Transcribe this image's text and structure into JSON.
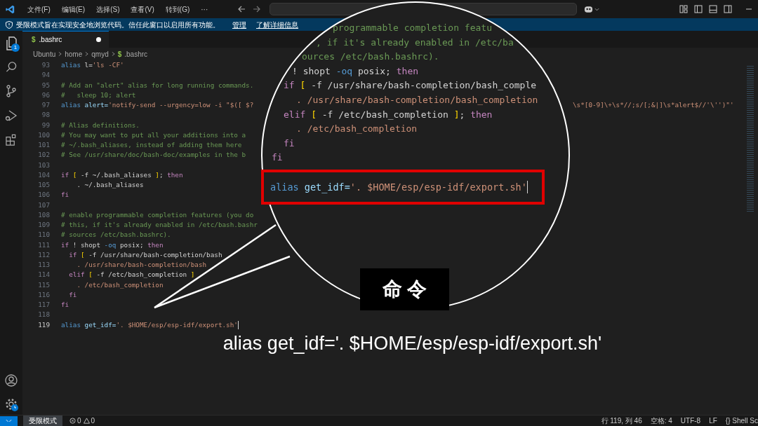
{
  "title_bar": {
    "menus": [
      "文件(F)",
      "编辑(E)",
      "选择(S)",
      "查看(V)",
      "转到(G)",
      "···"
    ]
  },
  "banner": {
    "message": "受限模式旨在实现安全地浏览代码。信任此窗口以启用所有功能。",
    "links": [
      "管理",
      "了解详细信息"
    ]
  },
  "activity_bar": {
    "explorer_badge": "1"
  },
  "tabs": [
    {
      "icon": "$",
      "label": ".bashrc",
      "modified": true,
      "selected": true
    }
  ],
  "breadcrumbs": [
    {
      "text": "Ubuntu"
    },
    {
      "text": "home"
    },
    {
      "text": "qmyd"
    },
    {
      "icon": "$",
      "text": ".bashrc"
    }
  ],
  "editor": {
    "lines": [
      {
        "number": "93",
        "segments": [
          {
            "text": "alias ",
            "kind": "keyword"
          },
          {
            "text": "l=",
            "kind": "plain"
          },
          {
            "text": "'ls -CF'",
            "kind": "string"
          }
        ]
      },
      {
        "number": "94"
      },
      {
        "number": "95",
        "segments": [
          {
            "text": "# Add an \"alert\" alias for long running commands.",
            "kind": "comment"
          }
        ]
      },
      {
        "number": "96",
        "segments": [
          {
            "text": "#   sleep 10; alert",
            "kind": "comment"
          }
        ]
      },
      {
        "number": "97",
        "segments": [
          {
            "text": "alias ",
            "kind": "keyword"
          },
          {
            "text": "alert=",
            "kind": "name"
          },
          {
            "text": "'notify-send --urgency=low -i \"$([ $?",
            "kind": "string"
          }
        ],
        "tail": "\\s*[0-9]\\+\\s*//;s/[;&|]\\s*alert$//'\\'')\"'"
      },
      {
        "number": "98"
      },
      {
        "number": "99",
        "segments": [
          {
            "text": "# Alias definitions.",
            "kind": "comment"
          }
        ]
      },
      {
        "number": "100",
        "segments": [
          {
            "text": "# You may want to put all your additions into a",
            "kind": "comment"
          }
        ]
      },
      {
        "number": "101",
        "segments": [
          {
            "text": "# ~/.bash_aliases, instead of adding them here",
            "kind": "comment"
          }
        ]
      },
      {
        "number": "102",
        "segments": [
          {
            "text": "# See /usr/share/doc/bash-doc/examples in the b",
            "kind": "comment"
          }
        ]
      },
      {
        "number": "103"
      },
      {
        "number": "104",
        "segments": [
          {
            "text": "if ",
            "kind": "control"
          },
          {
            "text": "[ ",
            "kind": "bracket"
          },
          {
            "text": "-f ~/.bash_aliases ",
            "kind": "plain"
          },
          {
            "text": "]",
            "kind": "bracket"
          },
          {
            "text": "; ",
            "kind": "plain"
          },
          {
            "text": "then",
            "kind": "control"
          }
        ]
      },
      {
        "number": "105",
        "segments": [
          {
            "text": "    . ~/.bash_aliases",
            "kind": "plain"
          }
        ]
      },
      {
        "number": "106",
        "segments": [
          {
            "text": "fi",
            "kind": "control"
          }
        ]
      },
      {
        "number": "107"
      },
      {
        "number": "108",
        "segments": [
          {
            "text": "# enable programmable completion features (you do",
            "kind": "comment"
          }
        ]
      },
      {
        "number": "109",
        "segments": [
          {
            "text": "# this, if it's already enabled in /etc/bash.bashr",
            "kind": "comment"
          }
        ]
      },
      {
        "number": "110",
        "segments": [
          {
            "text": "# sources /etc/bash.bashrc).",
            "kind": "comment"
          }
        ]
      },
      {
        "number": "111",
        "segments": [
          {
            "text": "if ",
            "kind": "control"
          },
          {
            "text": "! shopt ",
            "kind": "plain"
          },
          {
            "text": "-oq ",
            "kind": "keyword"
          },
          {
            "text": "posix; ",
            "kind": "plain"
          },
          {
            "text": "then",
            "kind": "control"
          }
        ]
      },
      {
        "number": "112",
        "segments": [
          {
            "text": "  if ",
            "kind": "control"
          },
          {
            "text": "[ ",
            "kind": "bracket"
          },
          {
            "text": "-f /usr/share/bash-completion/bash",
            "kind": "plain"
          }
        ]
      },
      {
        "number": "113",
        "segments": [
          {
            "text": "    . /usr/share/bash-completion/bash",
            "kind": "string"
          }
        ]
      },
      {
        "number": "114",
        "segments": [
          {
            "text": "  elif ",
            "kind": "control"
          },
          {
            "text": "[ ",
            "kind": "bracket"
          },
          {
            "text": "-f /etc/bash_completion ",
            "kind": "plain"
          },
          {
            "text": "]",
            "kind": "bracket"
          }
        ]
      },
      {
        "number": "115",
        "segments": [
          {
            "text": "    . /etc/bash_completion",
            "kind": "string"
          }
        ]
      },
      {
        "number": "116",
        "segments": [
          {
            "text": "  fi",
            "kind": "control"
          }
        ]
      },
      {
        "number": "117",
        "segments": [
          {
            "text": "fi",
            "kind": "control"
          }
        ]
      },
      {
        "number": "118"
      },
      {
        "number": "119",
        "current": true,
        "segments": [
          {
            "text": "alias ",
            "kind": "keyword"
          },
          {
            "text": "get_idf=",
            "kind": "name"
          },
          {
            "text": "'. $HOME/esp/esp-idf/export.sh'",
            "kind": "string"
          }
        ]
      }
    ]
  },
  "magnifier": {
    "lines": [
      {
        "segments": [
          {
            "text": "programmable completion featu",
            "kind": "comment"
          }
        ]
      },
      {
        "segments": [
          {
            "text": ", if it's already enabled in /etc/ba",
            "kind": "comment"
          }
        ]
      },
      {
        "segments": [
          {
            "text": "ources /etc/bash.bashrc).",
            "kind": "comment"
          }
        ]
      },
      {
        "segments": [
          {
            "text": "! shopt ",
            "kind": "plain"
          },
          {
            "text": "-oq ",
            "kind": "keyword"
          },
          {
            "text": "posix; ",
            "kind": "plain"
          },
          {
            "text": "then",
            "kind": "control"
          }
        ]
      },
      {
        "segments": [
          {
            "text": "if ",
            "kind": "control"
          },
          {
            "text": "[ ",
            "kind": "bracket"
          },
          {
            "text": "-f /usr/share/bash-completion/bash_comple",
            "kind": "plain"
          }
        ]
      },
      {
        "segments": [
          {
            "text": ". /usr/share/bash-completion/bash_completion",
            "kind": "string"
          }
        ]
      },
      {
        "segments": [
          {
            "text": "elif ",
            "kind": "control"
          },
          {
            "text": "[ ",
            "kind": "bracket"
          },
          {
            "text": "-f /etc/bash_completion ",
            "kind": "plain"
          },
          {
            "text": "]",
            "kind": "bracket"
          },
          {
            "text": "; ",
            "kind": "plain"
          },
          {
            "text": "then",
            "kind": "control"
          }
        ]
      },
      {
        "segments": [
          {
            "text": ". /etc/bash_completion",
            "kind": "string"
          }
        ]
      },
      {
        "segments": [
          {
            "text": "fi",
            "kind": "control"
          }
        ]
      },
      {
        "segments": [
          {
            "text": "fi",
            "kind": "control"
          }
        ]
      }
    ],
    "highlighted": {
      "segments": [
        {
          "text": "alias ",
          "kind": "keyword"
        },
        {
          "text": "get_idf=",
          "kind": "name"
        },
        {
          "text": "'. $HOME/esp/esp-idf/export.sh'",
          "kind": "string"
        }
      ]
    }
  },
  "caption_label": "命 令",
  "subtitle": "alias get_idf='. $HOME/esp/esp-idf/export.sh'",
  "status_bar": {
    "mode": "受限模式",
    "errors": "0",
    "warnings": "0",
    "items": [
      "行 119, 列 46",
      "空格: 4",
      "UTF-8",
      "LF",
      "{} Shell Sc"
    ]
  }
}
